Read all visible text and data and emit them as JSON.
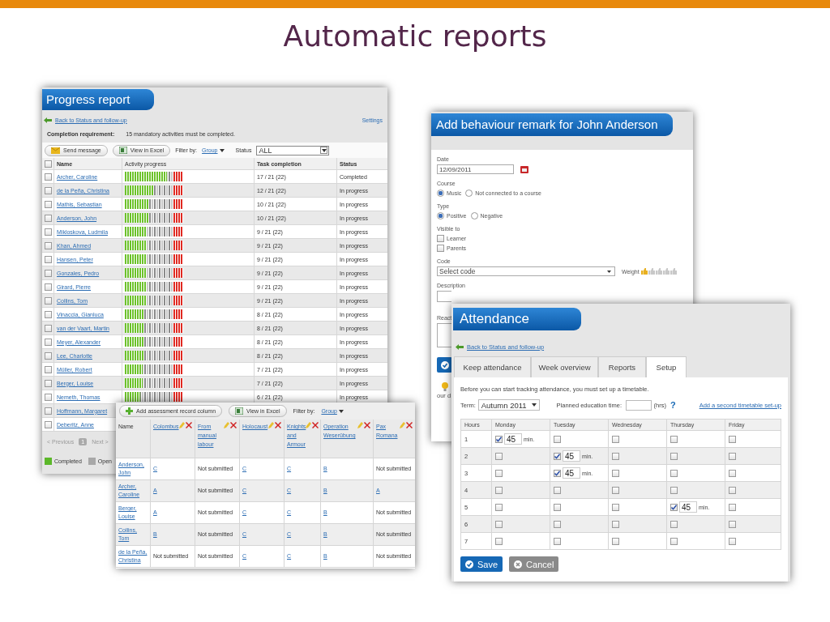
{
  "slide": {
    "title": "Automatic reports"
  },
  "progress_report": {
    "title": "Progress report",
    "back_link": "Back to Status and follow-up",
    "settings_link": "Settings",
    "requirement_label": "Completion requirement:",
    "requirement_text": "15 mandatory activities must be completed.",
    "toolbar": {
      "send_message": "Send message",
      "view_excel": "View in Excel",
      "filter_label": "Filter by:",
      "filter_value": "Group",
      "status_label": "Status",
      "status_value": "ALL"
    },
    "select_all_checked": false,
    "columns": [
      "Name",
      "Activity progress",
      "Task completion",
      "Status"
    ],
    "rows": [
      {
        "name": "Archer, Caroline",
        "checked": false,
        "level": 0.72,
        "task": "17 / 21 (22)",
        "status": "Completed"
      },
      {
        "name": "de la Peña, Christina",
        "checked": false,
        "level": 0.5,
        "task": "12 / 21 (22)",
        "status": "In progress"
      },
      {
        "name": "Mathis, Sebastian",
        "checked": false,
        "level": 0.42,
        "task": "10 / 21 (22)",
        "status": "In progress"
      },
      {
        "name": "Anderson, John",
        "checked": false,
        "level": 0.42,
        "task": "10 / 21 (22)",
        "status": "In progress"
      },
      {
        "name": "Mikloskova, Ludmila",
        "checked": false,
        "level": 0.38,
        "task": "9 / 21 (22)",
        "status": "In progress"
      },
      {
        "name": "Khan, Ahmed",
        "checked": false,
        "level": 0.38,
        "task": "9 / 21 (22)",
        "status": "In progress"
      },
      {
        "name": "Hansen, Peter",
        "checked": false,
        "level": 0.38,
        "task": "9 / 21 (22)",
        "status": "In progress"
      },
      {
        "name": "Gonzales, Pedro",
        "checked": false,
        "level": 0.38,
        "task": "9 / 21 (22)",
        "status": "In progress"
      },
      {
        "name": "Girard, Pierre",
        "checked": false,
        "level": 0.38,
        "task": "9 / 21 (22)",
        "status": "In progress"
      },
      {
        "name": "Collins, Tom",
        "checked": false,
        "level": 0.38,
        "task": "9 / 21 (22)",
        "status": "In progress"
      },
      {
        "name": "Vinaccia, Gianluca",
        "checked": false,
        "level": 0.34,
        "task": "8 / 21 (22)",
        "status": "In progress"
      },
      {
        "name": "van der Vaart, Martin",
        "checked": false,
        "level": 0.34,
        "task": "8 / 21 (22)",
        "status": "In progress"
      },
      {
        "name": "Meyer, Alexander",
        "checked": false,
        "level": 0.34,
        "task": "8 / 21 (22)",
        "status": "In progress"
      },
      {
        "name": "Lee, Charlotte",
        "checked": false,
        "level": 0.34,
        "task": "8 / 21 (22)",
        "status": "In progress"
      },
      {
        "name": "Müller, Robert",
        "checked": false,
        "level": 0.3,
        "task": "7 / 21 (22)",
        "status": "In progress"
      },
      {
        "name": "Berger, Louise",
        "checked": false,
        "level": 0.3,
        "task": "7 / 21 (22)",
        "status": "In progress"
      },
      {
        "name": "Nemeth, Thomas",
        "checked": false,
        "level": 0.26,
        "task": "6 / 21 (22)",
        "status": "In progress"
      },
      {
        "name": "Hoffmann, Margaret",
        "checked": false
      },
      {
        "name": "Deberitz, Anne",
        "checked": false
      }
    ],
    "pagination": {
      "previous": "< Previous",
      "page": "1",
      "next": "Next >"
    },
    "legend": [
      {
        "label": "Completed",
        "color": "#5cb82a"
      },
      {
        "label": "Open",
        "color": "#a8a8a8"
      }
    ]
  },
  "assessment": {
    "toolbar": {
      "add_column": "Add assessment record column",
      "view_excel": "View in Excel",
      "filter_label": "Filter by:",
      "filter_value": "Group"
    },
    "columns": [
      "Name",
      "Colombus",
      "From manual labour",
      "Holocaust",
      "Knights and Armour",
      "Operation Weserübung",
      "Pax Romana"
    ],
    "rows": [
      {
        "cells": [
          {
            "kind": "name",
            "text": "Anderson, John"
          },
          {
            "kind": "grade",
            "text": "C"
          },
          {
            "kind": "missing",
            "text": "Not submitted"
          },
          {
            "kind": "grade",
            "text": "C"
          },
          {
            "kind": "grade",
            "text": "C"
          },
          {
            "kind": "grade",
            "text": "B"
          },
          {
            "kind": "missing",
            "text": "Not submitted"
          }
        ]
      },
      {
        "cells": [
          {
            "kind": "name",
            "text": "Archer, Caroline"
          },
          {
            "kind": "grade",
            "text": "A"
          },
          {
            "kind": "missing",
            "text": "Not submitted"
          },
          {
            "kind": "grade",
            "text": "C"
          },
          {
            "kind": "grade",
            "text": "C"
          },
          {
            "kind": "grade",
            "text": "B"
          },
          {
            "kind": "grade",
            "text": "A"
          }
        ]
      },
      {
        "cells": [
          {
            "kind": "name",
            "text": "Berger, Louise"
          },
          {
            "kind": "grade",
            "text": "A"
          },
          {
            "kind": "missing",
            "text": "Not submitted"
          },
          {
            "kind": "grade",
            "text": "C"
          },
          {
            "kind": "grade",
            "text": "C"
          },
          {
            "kind": "grade",
            "text": "B"
          },
          {
            "kind": "missing",
            "text": "Not submitted"
          }
        ]
      },
      {
        "cells": [
          {
            "kind": "name",
            "text": "Collins, Tom"
          },
          {
            "kind": "grade",
            "text": "B"
          },
          {
            "kind": "missing",
            "text": "Not submitted"
          },
          {
            "kind": "grade",
            "text": "C"
          },
          {
            "kind": "grade",
            "text": "C"
          },
          {
            "kind": "grade",
            "text": "B"
          },
          {
            "kind": "missing",
            "text": "Not submitted"
          }
        ]
      },
      {
        "cells": [
          {
            "kind": "name",
            "text": "de la Peña, Christina"
          },
          {
            "kind": "missing",
            "text": "Not submitted"
          },
          {
            "kind": "missing",
            "text": "Not submitted"
          },
          {
            "kind": "grade",
            "text": "C"
          },
          {
            "kind": "grade",
            "text": "C"
          },
          {
            "kind": "grade",
            "text": "B"
          },
          {
            "kind": "missing",
            "text": "Not submitted"
          }
        ]
      }
    ]
  },
  "behaviour": {
    "title": "Add behaviour remark for John Anderson",
    "date_label": "Date",
    "date_value": "12/09/2011",
    "course_label": "Course",
    "course_options": [
      {
        "label": "Music",
        "selected": true
      },
      {
        "label": "Not connected to a course",
        "selected": false
      }
    ],
    "type_label": "Type",
    "type_options": [
      {
        "label": "Positive",
        "selected": true
      },
      {
        "label": "Negative",
        "selected": false
      }
    ],
    "visible_label": "Visible to",
    "visible_options": [
      {
        "label": "Learner",
        "checked": false
      },
      {
        "label": "Parents",
        "checked": false
      }
    ],
    "code_label": "Code",
    "code_value": "Select code",
    "weight": {
      "label": "Weight",
      "stars": 1
    },
    "description_label": "Description",
    "reactions_label": "React",
    "tip_text": "our d"
  },
  "attendance": {
    "title": "Attendance",
    "back_link": "Back to Status and follow-up",
    "tabs": [
      {
        "label": "Keep attendance",
        "selected": false
      },
      {
        "label": "Week overview",
        "selected": false
      },
      {
        "label": "Reports",
        "selected": false
      },
      {
        "label": "Setup",
        "selected": true
      }
    ],
    "intro": "Before you can start tracking attendance, you must set up a timetable.",
    "term_label": "Term:",
    "term_value": "Autumn 2011",
    "planned_label": "Planned education time:",
    "planned_unit": "(hrs)",
    "help": "?",
    "add_link": "Add a second timetable set-up",
    "columns": [
      "Hours",
      "Monday",
      "Tuesday",
      "Wednesday",
      "Thursday",
      "Friday"
    ],
    "rows": [
      {
        "hour": "1",
        "days": [
          {
            "checked": true,
            "minutes": "45",
            "unit": "min."
          },
          {
            "checked": false
          },
          {
            "checked": false
          },
          {
            "checked": false
          },
          {
            "checked": false
          }
        ]
      },
      {
        "hour": "2",
        "days": [
          {
            "checked": false
          },
          {
            "checked": true,
            "minutes": "45",
            "unit": "min."
          },
          {
            "checked": false
          },
          {
            "checked": false
          },
          {
            "checked": false
          }
        ]
      },
      {
        "hour": "3",
        "days": [
          {
            "checked": false
          },
          {
            "checked": true,
            "minutes": "45",
            "unit": "min."
          },
          {
            "checked": false
          },
          {
            "checked": false
          },
          {
            "checked": false
          }
        ]
      },
      {
        "hour": "4",
        "days": [
          {
            "checked": false
          },
          {
            "checked": false
          },
          {
            "checked": false
          },
          {
            "checked": false
          },
          {
            "checked": false
          }
        ]
      },
      {
        "hour": "5",
        "days": [
          {
            "checked": false
          },
          {
            "checked": false
          },
          {
            "checked": false
          },
          {
            "checked": true,
            "minutes": "45",
            "unit": "min."
          },
          {
            "checked": false
          }
        ]
      },
      {
        "hour": "6",
        "days": [
          {
            "checked": false
          },
          {
            "checked": false
          },
          {
            "checked": false
          },
          {
            "checked": false
          },
          {
            "checked": false
          }
        ]
      },
      {
        "hour": "7",
        "days": [
          {
            "checked": false
          },
          {
            "checked": false
          },
          {
            "checked": false
          },
          {
            "checked": false
          },
          {
            "checked": false
          }
        ]
      }
    ],
    "buttons": [
      {
        "kind": "primary",
        "label": "Save"
      },
      {
        "kind": "secondary",
        "label": "Cancel"
      }
    ]
  }
}
